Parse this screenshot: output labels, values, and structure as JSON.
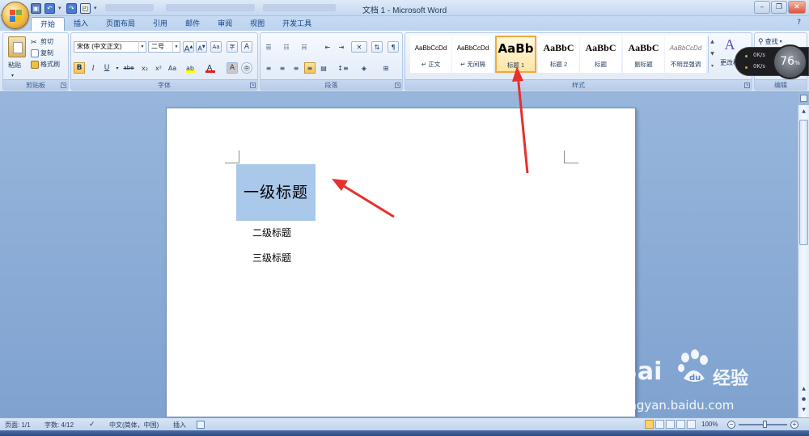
{
  "window": {
    "title": "文档 1 - Microsoft Word",
    "buttons": [
      "–",
      "❐",
      "✕"
    ]
  },
  "tabs": [
    "开始",
    "插入",
    "页面布局",
    "引用",
    "邮件",
    "审阅",
    "视图",
    "开发工具"
  ],
  "clipboard": {
    "paste": "粘贴",
    "cut": "剪切",
    "copy": "复制",
    "format_painter": "格式刷",
    "label": "剪贴板"
  },
  "font": {
    "name": "宋体 (中文正文)",
    "size": "二号",
    "label": "字体",
    "bold": "B",
    "italic": "I",
    "underline": "U",
    "strike": "abe",
    "sub": "x₂",
    "sup": "x²",
    "case": "Aa",
    "grow": "A",
    "shrink": "A",
    "phonetic": "A",
    "border": "A",
    "enclose": "字",
    "highlight": "ab",
    "color": "A",
    "shade": "A",
    "font_color_hex": "#e02020",
    "highlight_hex": "#ffff00"
  },
  "paragraph": {
    "label": "段落"
  },
  "styles": {
    "label": "样式",
    "items": [
      {
        "sample": "AaBbCcDd",
        "name": "↵ 正文"
      },
      {
        "sample": "AaBbCcDd",
        "name": "↵ 无间隔"
      },
      {
        "sample": "AaBb",
        "name": "标题 1"
      },
      {
        "sample": "AaBbC",
        "name": "标题 2"
      },
      {
        "sample": "AaBbC",
        "name": "标题"
      },
      {
        "sample": "AaBbC",
        "name": "副标题"
      },
      {
        "sample": "AaBbCcDd",
        "name": "不明显强调"
      }
    ],
    "change_styles": "更改样",
    "selected_index": 2
  },
  "editing": {
    "find": "查找",
    "label": "编辑"
  },
  "gauge": {
    "up": "0K/s",
    "down": "0K/s",
    "percent": "76",
    "unit": "%"
  },
  "document": {
    "heading1": "一级标题",
    "heading2": "二级标题",
    "heading3": "三级标题"
  },
  "watermark": {
    "brand": "Bai",
    "brand_suffix": "经验",
    "url": "jingyan.baidu.com"
  },
  "status": {
    "page": "页面: 1/1",
    "words": "字数: 4/12",
    "language": "中文(简体，中国)",
    "mode": "插入",
    "zoom": "100%",
    "zoom_minus": "−",
    "zoom_plus": "+"
  },
  "colors": {
    "accent_arrow": "#e8302c",
    "selection": "#a9c8ea",
    "ribbon_bg": "#dde8f6"
  }
}
